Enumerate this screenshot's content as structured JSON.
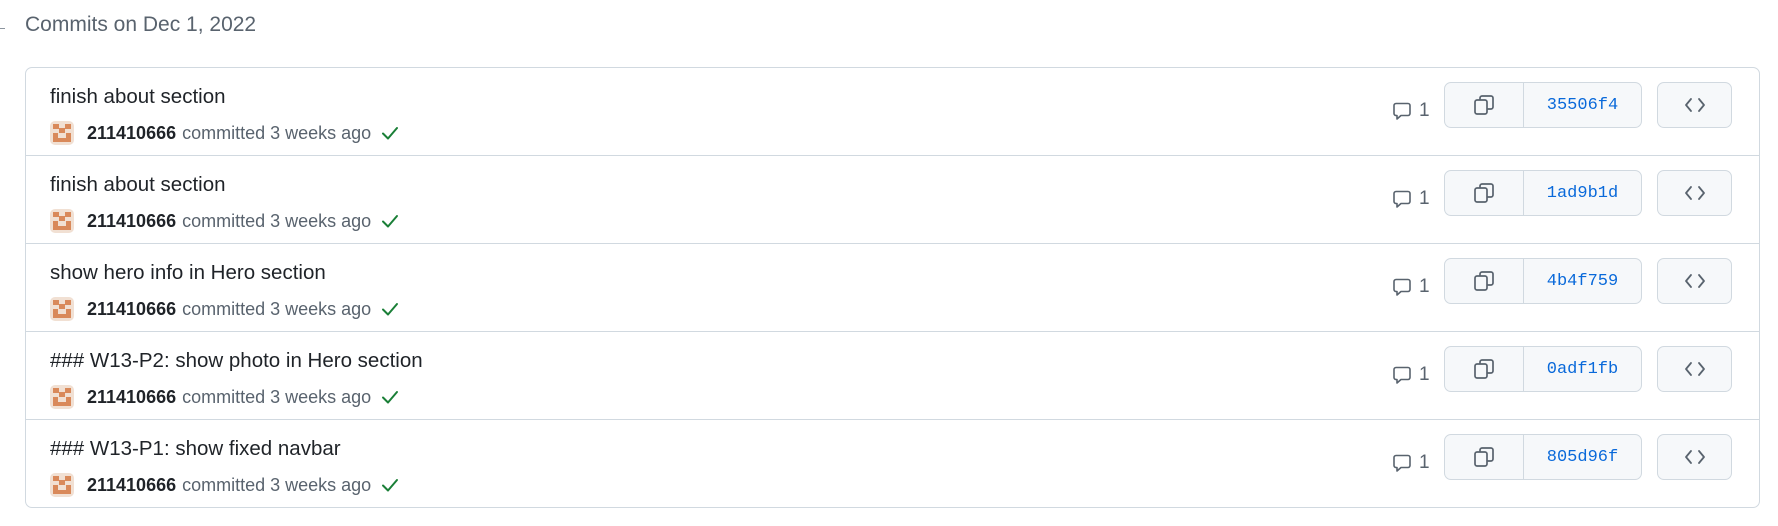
{
  "group": {
    "title": "Commits on Dec 1, 2022"
  },
  "commits": [
    {
      "title": "finish about section",
      "author": "211410666",
      "meta": "committed 3 weeks ago",
      "comments": "1",
      "sha": "35506f4"
    },
    {
      "title": "finish about section",
      "author": "211410666",
      "meta": "committed 3 weeks ago",
      "comments": "1",
      "sha": "1ad9b1d"
    },
    {
      "title": "show hero info in Hero section",
      "author": "211410666",
      "meta": "committed 3 weeks ago",
      "comments": "1",
      "sha": "4b4f759"
    },
    {
      "title": "### W13-P2: show photo in Hero section",
      "author": "211410666",
      "meta": "committed 3 weeks ago",
      "comments": "1",
      "sha": "0adf1fb"
    },
    {
      "title": "### W13-P1: show fixed navbar",
      "author": "211410666",
      "meta": "committed 3 weeks ago",
      "comments": "1",
      "sha": "805d96f"
    }
  ],
  "icons": {
    "comment": "comment-icon",
    "copy": "copy-icon",
    "browse": "code-icon",
    "status": "check-icon",
    "avatar": "identicon-avatar"
  },
  "colors": {
    "sha_link": "#0969da",
    "success": "#1a7f37",
    "avatar": "#d9895a",
    "border": "#d1d9e0"
  }
}
